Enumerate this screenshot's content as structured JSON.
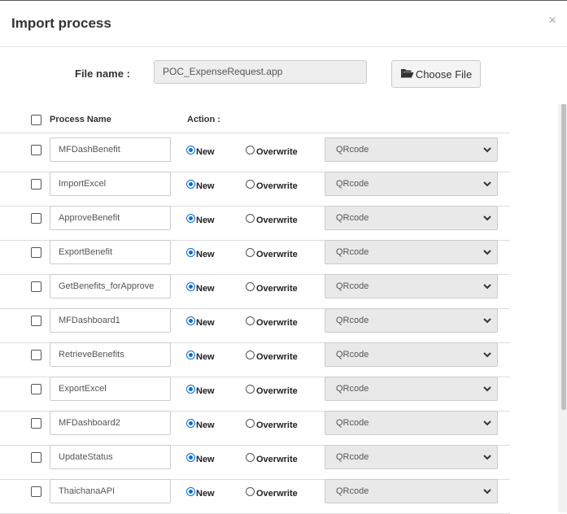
{
  "modal": {
    "title": "Import process",
    "close_label": "×"
  },
  "file": {
    "label": "File name :",
    "value": "POC_ExpenseRequest.app",
    "choose_label": "Choose File"
  },
  "table": {
    "header_process": "Process Name",
    "header_action": "Action :",
    "new_label": "New",
    "overwrite_label": "Overwrite",
    "rows": [
      {
        "name": "MFDashBenefit",
        "select": "QRcode"
      },
      {
        "name": "ImportExcel",
        "select": "QRcode"
      },
      {
        "name": "ApproveBenefit",
        "select": "QRcode"
      },
      {
        "name": "ExportBenefit",
        "select": "QRcode"
      },
      {
        "name": "GetBenefits_forApprove",
        "select": "QRcode"
      },
      {
        "name": "MFDashboard1",
        "select": "QRcode"
      },
      {
        "name": "RetrieveBenefits",
        "select": "QRcode"
      },
      {
        "name": "ExportExcel",
        "select": "QRcode"
      },
      {
        "name": "MFDashboard2",
        "select": "QRcode"
      },
      {
        "name": "UpdateStatus",
        "select": "QRcode"
      },
      {
        "name": "ThaichanaAPI",
        "select": "QRcode"
      }
    ]
  }
}
